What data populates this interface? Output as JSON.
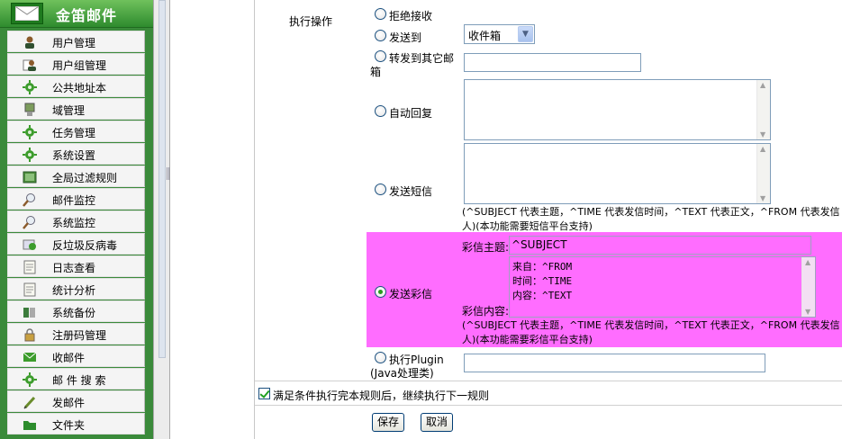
{
  "app": {
    "title": "金笛邮件"
  },
  "sidebar": {
    "items": [
      {
        "label": "用户管理",
        "icon": "user-icon"
      },
      {
        "label": "用户组管理",
        "icon": "user-group-icon"
      },
      {
        "label": "公共地址本",
        "icon": "gear-icon"
      },
      {
        "label": "域管理",
        "icon": "domain-icon"
      },
      {
        "label": "任务管理",
        "icon": "gear-icon"
      },
      {
        "label": "系统设置",
        "icon": "gear-icon"
      },
      {
        "label": "全局过滤规则",
        "icon": "filter-icon"
      },
      {
        "label": "邮件监控",
        "icon": "magnifier-icon"
      },
      {
        "label": "系统监控",
        "icon": "magnifier-icon"
      },
      {
        "label": "反垃圾反病毒",
        "icon": "antispam-icon"
      },
      {
        "label": "日志查看",
        "icon": "document-icon"
      },
      {
        "label": "统计分析",
        "icon": "document-icon"
      },
      {
        "label": "系统备份",
        "icon": "backup-icon"
      },
      {
        "label": "注册码管理",
        "icon": "lock-icon"
      },
      {
        "label": "收邮件",
        "icon": "envelope-icon"
      },
      {
        "label": "邮 件 搜 索",
        "icon": "gear-icon"
      },
      {
        "label": "发邮件",
        "icon": "pen-icon"
      },
      {
        "label": "文件夹",
        "icon": "folder-icon"
      }
    ]
  },
  "form": {
    "section_label": "执行操作",
    "options": {
      "reject": "拒绝接收",
      "send_to": "发送到",
      "forward_line1": "转发到其它邮",
      "forward_line2": "箱",
      "auto_reply": "自动回复",
      "send_sms": "发送短信",
      "send_mms": "发送彩信",
      "plugin_line1": "执行Plugin",
      "plugin_line2": "(Java处理类)"
    },
    "send_to_select": {
      "selected": "收件箱"
    },
    "sms_hint": "(^SUBJECT 代表主题，^TIME 代表发信时间，^TEXT 代表正文，^FROM 代表发信人)(本功能需要短信平台支持)",
    "mms_subject_label": "彩信主题:",
    "mms_subject_value": "^SUBJECT",
    "mms_content_label": "彩信内容:",
    "mms_content_lines": [
      "来自：^FROM",
      "时间：^TIME",
      "内容：^TEXT"
    ],
    "mms_hint": "(^SUBJECT 代表主题，^TIME 代表发信时间，^TEXT 代表正文，^FROM 代表发信人)(本功能需要彩信平台支持)",
    "continue_label": "满足条件执行完本规则后，继续执行下一规则",
    "save_label": "保存",
    "cancel_label": "取消",
    "highlight_color": "#ff6dff"
  }
}
